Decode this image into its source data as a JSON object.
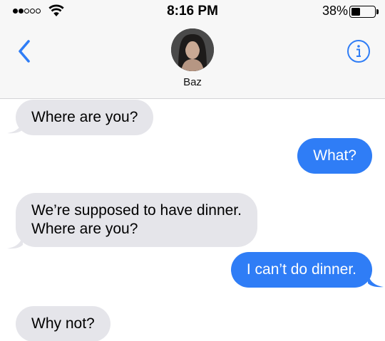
{
  "status_bar": {
    "time": "8:16 PM",
    "battery_percent_label": "38%",
    "battery_level": 0.38,
    "signal_bars_filled": 2,
    "signal_bars_total": 5,
    "wifi_icon": "wifi-icon"
  },
  "header": {
    "back_icon": "chevron-left-icon",
    "contact_name": "Baz",
    "info_icon": "info-icon"
  },
  "messages": [
    {
      "direction": "incoming",
      "text": "Where are you?"
    },
    {
      "direction": "outgoing",
      "text": "What?"
    },
    {
      "direction": "incoming",
      "text": "We’re supposed to have dinner.\nWhere are you?"
    },
    {
      "direction": "outgoing",
      "text": "I can’t do dinner."
    },
    {
      "direction": "incoming",
      "text": "Why not?"
    }
  ],
  "colors": {
    "accent": "#2f7df6",
    "incoming_bubble": "#e5e5ea",
    "header_background": "#f7f7f7"
  }
}
